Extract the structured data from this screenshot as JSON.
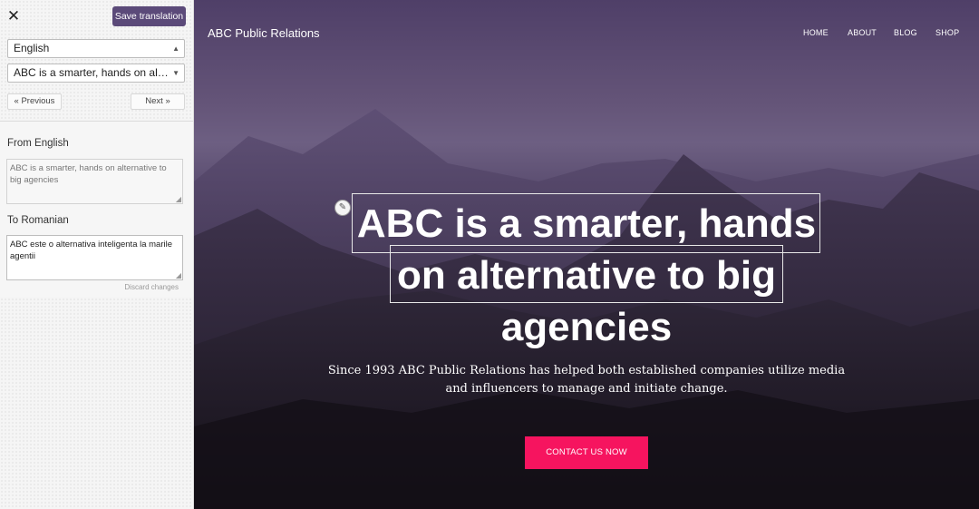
{
  "sidebar": {
    "close_glyph": "✕",
    "save_label": "Save translation",
    "language_select": "English",
    "string_select": "ABC is a smarter, hands on alter...",
    "previous_label": "« Previous",
    "next_label": "Next »",
    "from_label": "From English",
    "source_text": "ABC is a smarter, hands on alternative to big agencies",
    "to_label": "To Romanian",
    "target_text": "ABC este o alternativa inteligenta la marile agentii",
    "discard_label": "Discard changes",
    "accent_color": "#5b4a79"
  },
  "site": {
    "title": "ABC Public Relations",
    "nav": [
      "HOME",
      "ABOUT",
      "BLOG",
      "SHOP"
    ]
  },
  "hero": {
    "headline_lines": [
      "ABC is a smarter, hands",
      "on alternative to big",
      "agencies"
    ],
    "subtext": "Since 1993 ABC Public Relations has helped both established companies utilize media and influencers to manage and initiate change.",
    "cta_label": "CONTACT US NOW",
    "cta_color": "#f6145f",
    "edit_icon": "pencil-icon"
  }
}
